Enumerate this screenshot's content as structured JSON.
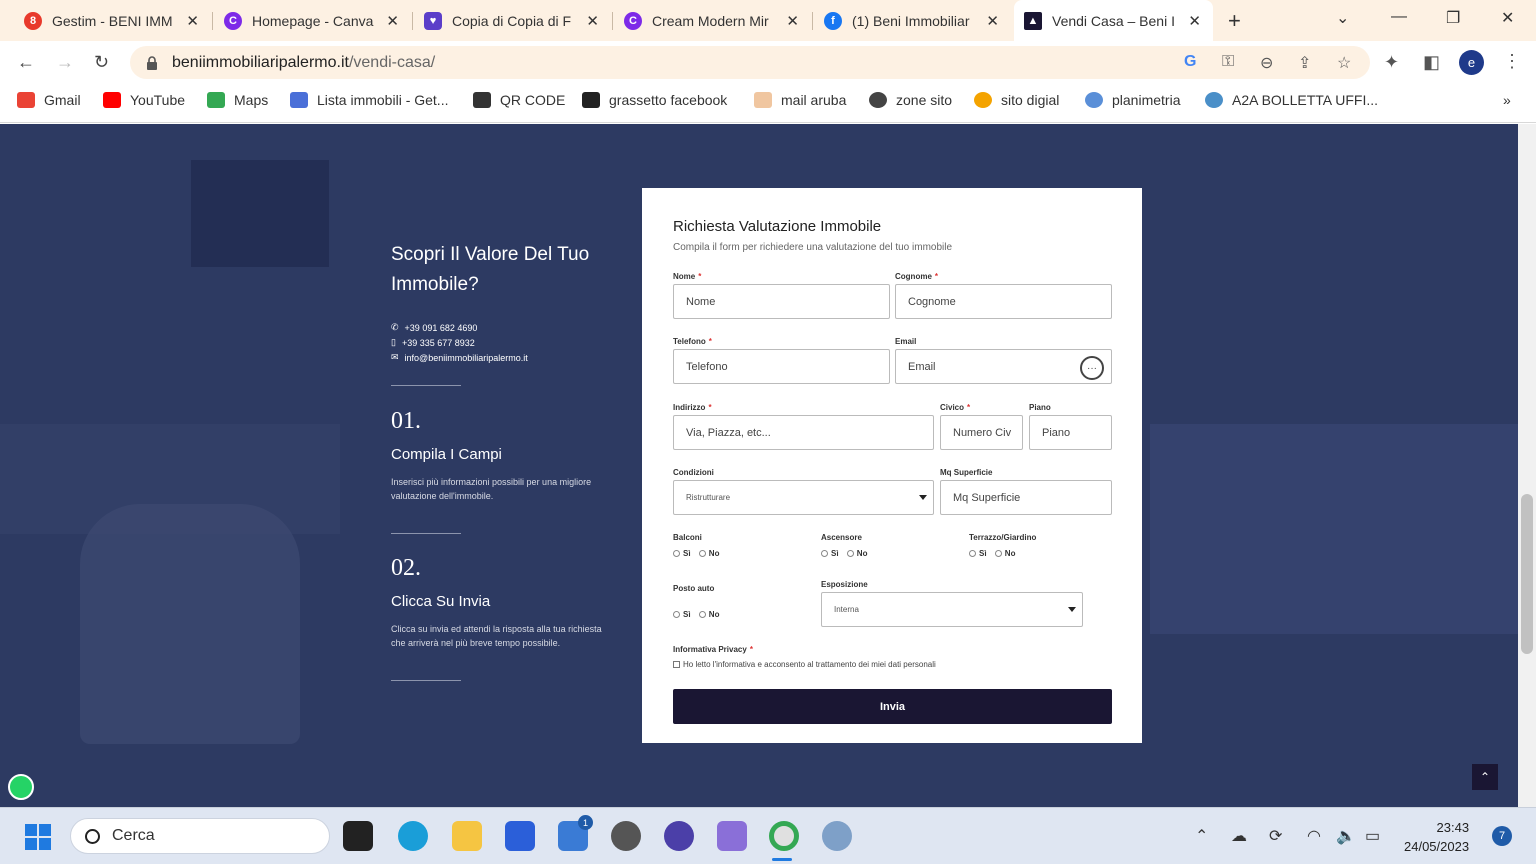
{
  "browser": {
    "tabs": [
      {
        "label": "Gestim - BENI IMM",
        "icon": "gestim-icon",
        "color": "#e8392b"
      },
      {
        "label": "Homepage - Canva",
        "icon": "canva-icon",
        "color": "#7d2ae8"
      },
      {
        "label": "Copia di Copia di F",
        "icon": "heart-icon",
        "color": "#5b3ec9"
      },
      {
        "label": "Cream Modern Mir",
        "icon": "canva-icon",
        "color": "#7d2ae8"
      },
      {
        "label": "(1) Beni Immobiliar",
        "icon": "facebook-icon",
        "color": "#1877f2"
      },
      {
        "label": "Vendi Casa – Beni I",
        "icon": "site-logo-icon",
        "color": "#1a1633"
      }
    ],
    "url_domain": "beniimmobiliaripalermo.it",
    "url_path": "/vendi-casa/",
    "bookmarks": [
      {
        "label": "Gmail",
        "icon": "gmail-icon",
        "color": "#ea4335"
      },
      {
        "label": "YouTube",
        "icon": "youtube-icon",
        "color": "#ff0000"
      },
      {
        "label": "Maps",
        "icon": "maps-icon",
        "color": "#34a853"
      },
      {
        "label": "Lista immobili - Get...",
        "icon": "house-icon",
        "color": "#4a6fd8"
      },
      {
        "label": "QR CODE",
        "icon": "qr-icon",
        "color": "#333333"
      },
      {
        "label": "grassetto facebook",
        "icon": "yaytext-icon",
        "color": "#222222"
      },
      {
        "label": "mail aruba",
        "icon": "hand-icon",
        "color": "#f0c6a0"
      },
      {
        "label": "zone sito",
        "icon": "globe-icon",
        "color": "#444444"
      },
      {
        "label": "sito digial",
        "icon": "digial-icon",
        "color": "#f4a300"
      },
      {
        "label": "planimetria",
        "icon": "planimetria-icon",
        "color": "#5a8fd8"
      },
      {
        "label": "A2A BOLLETTA UFFI...",
        "icon": "a2a-icon",
        "color": "#4a8fc8"
      }
    ]
  },
  "page": {
    "heading": "Scopri Il Valore Del Tuo Immobile?",
    "contacts": [
      "+39 091 682 4690",
      "+39 335 677 8932",
      "info@beniimmobiliaripalermo.it"
    ],
    "steps": [
      {
        "num": "01.",
        "title": "Compila I Campi",
        "desc": "Inserisci più informazioni possibili per una migliore valutazione dell'immobile."
      },
      {
        "num": "02.",
        "title": "Clicca Su Invia",
        "desc": "Clicca su invia ed attendi la risposta alla tua richiesta che arriverà nel più breve tempo possibile."
      }
    ]
  },
  "form": {
    "title": "Richiesta Valutazione Immobile",
    "subtitle": "Compila il form per richiedere una valutazione del tuo immobile",
    "nome": {
      "label": "Nome",
      "placeholder": "Nome"
    },
    "cognome": {
      "label": "Cognome",
      "placeholder": "Cognome"
    },
    "telefono": {
      "label": "Telefono",
      "placeholder": "Telefono"
    },
    "email": {
      "label": "Email",
      "placeholder": "Email"
    },
    "indirizzo": {
      "label": "Indirizzo",
      "placeholder": "Via, Piazza, etc..."
    },
    "civico": {
      "label": "Civico",
      "placeholder": "Numero Civ"
    },
    "piano": {
      "label": "Piano",
      "placeholder": "Piano"
    },
    "condizioni": {
      "label": "Condizioni",
      "value": "Ristrutturare"
    },
    "mq": {
      "label": "Mq Superficie",
      "placeholder": "Mq Superficie"
    },
    "balconi": {
      "label": "Balconi"
    },
    "ascensore": {
      "label": "Ascensore"
    },
    "terrazzo": {
      "label": "Terrazzo/Giardino"
    },
    "posto_auto": {
      "label": "Posto auto"
    },
    "esposizione": {
      "label": "Esposizione",
      "value": "Interna"
    },
    "radio_yes": "Sì",
    "radio_no": "No",
    "privacy_label": "Informativa Privacy",
    "privacy_text": "Ho letto l'informativa e acconsento al trattamento dei miei dati personali",
    "required_mark": "*",
    "submit": "Invia"
  },
  "taskbar": {
    "search_placeholder": "Cerca",
    "time": "23:43",
    "date": "24/05/2023",
    "notifications": "7",
    "mail_badge": "1"
  }
}
